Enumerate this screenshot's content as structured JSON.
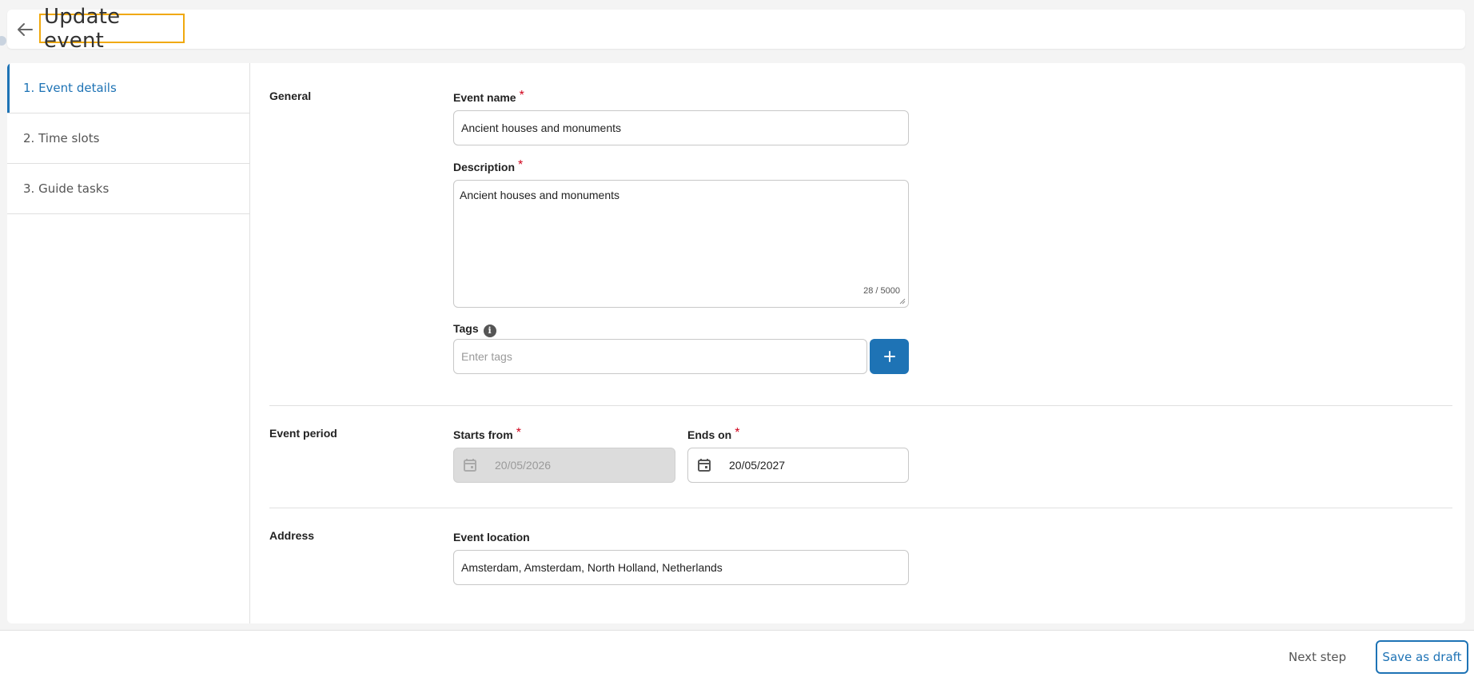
{
  "header": {
    "title": "Update event",
    "back_icon": "arrow-left-icon"
  },
  "steps": [
    {
      "label": "1. Event details",
      "active": true
    },
    {
      "label": "2. Time slots",
      "active": false
    },
    {
      "label": "3. Guide tasks",
      "active": false
    }
  ],
  "general": {
    "section_label": "General",
    "event_name": {
      "label": "Event name",
      "required_mark": "*",
      "value": "Ancient houses and monuments"
    },
    "description": {
      "label": "Description",
      "required_mark": "*",
      "value": "Ancient houses and monuments",
      "counter": "28 / 5000"
    },
    "tags": {
      "label": "Tags",
      "info_icon": "info-icon",
      "placeholder": "Enter tags",
      "add_icon": "plus-icon"
    }
  },
  "event_period": {
    "section_label": "Event period",
    "starts_from": {
      "label": "Starts from",
      "required_mark": "*",
      "value": "20/05/2026",
      "icon": "calendar-icon"
    },
    "ends_on": {
      "label": "Ends on",
      "required_mark": "*",
      "value": "20/05/2027",
      "icon": "calendar-icon"
    }
  },
  "address": {
    "section_label": "Address",
    "event_location": {
      "label": "Event location",
      "value": "Amsterdam, Amsterdam, North Holland, Netherlands"
    }
  },
  "footer": {
    "next_step": "Next step",
    "save_draft": "Save as draft"
  },
  "colors": {
    "accent": "#1e73b5",
    "highlight": "#f0a90e",
    "required": "#d0021b"
  }
}
